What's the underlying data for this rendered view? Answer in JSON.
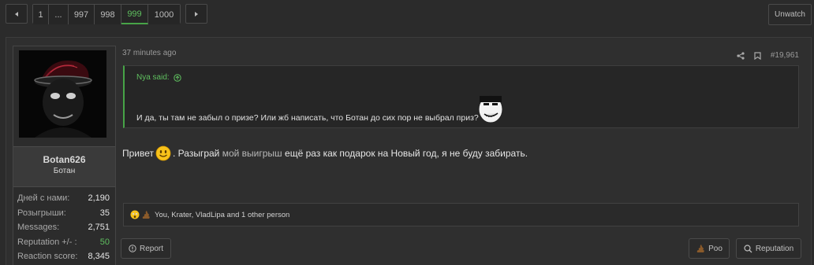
{
  "pagination": {
    "pages": [
      "1",
      "...",
      "997",
      "998",
      "999",
      "1000"
    ],
    "current": "999"
  },
  "thread": {
    "unwatch_label": "Unwatch"
  },
  "user": {
    "name": "Botan626",
    "title": "Ботан",
    "stats": [
      {
        "label": "Дней с нами:",
        "value": "2,190"
      },
      {
        "label": "Розыгрыши:",
        "value": "35"
      },
      {
        "label": "Messages:",
        "value": "2,751"
      },
      {
        "label": "Reputation +/- :",
        "value": "50"
      },
      {
        "label": "Reaction score:",
        "value": "8,345"
      }
    ]
  },
  "post": {
    "time": "37 minutes ago",
    "number": "#19,961",
    "quote": {
      "author": "Nya said:",
      "text": "И да, ты там не забыл о призе? Или жб написать, что Ботан до сих пор не выбрал приз?"
    },
    "body": {
      "part1": "Привет",
      "part2": ". Разыграй ",
      "highlight": "мой выигрыш",
      "part3": " ещё раз как подарок на Новый год, я не буду забирать."
    },
    "reactions_text": "You, Krater, VladLipa and 1 other person"
  },
  "buttons": {
    "report": "Report",
    "poo": "Poo",
    "reputation": "Reputation"
  },
  "colors": {
    "accent": "#47a447",
    "background": "#2b2b2b"
  }
}
